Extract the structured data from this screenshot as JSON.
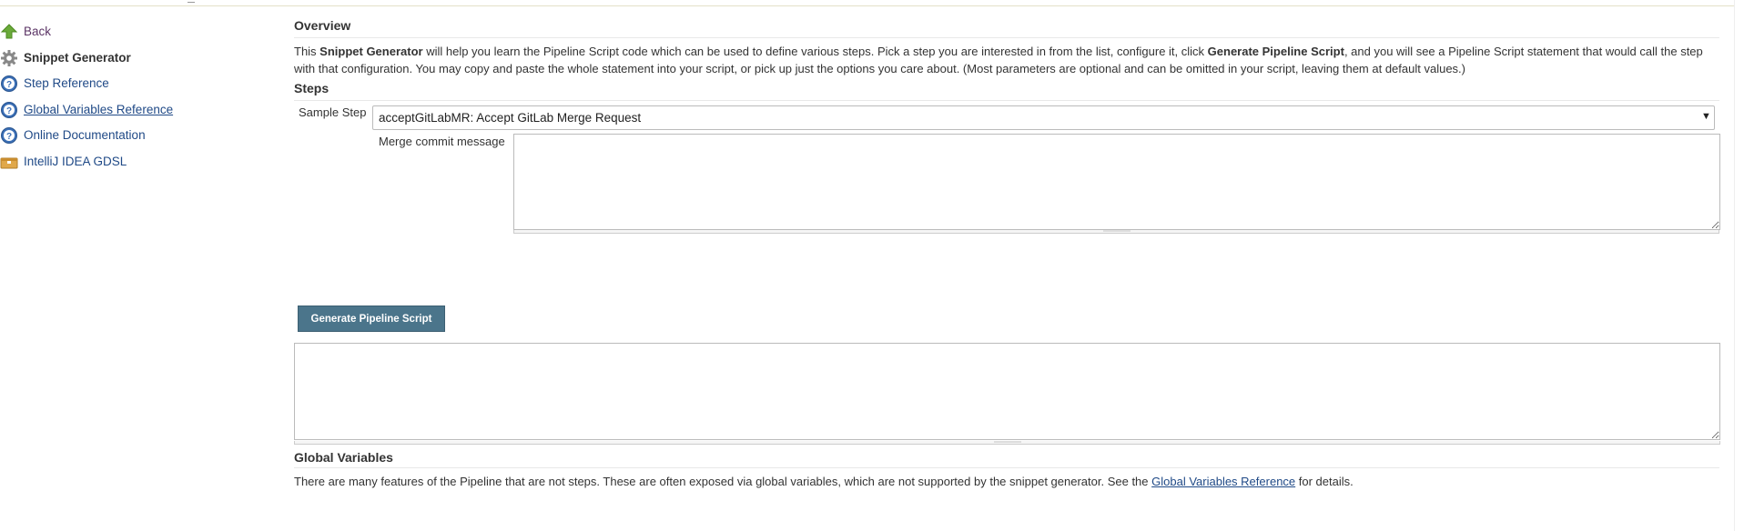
{
  "sidebar": {
    "items": [
      {
        "label": "Back",
        "icon": "up-arrow-icon"
      },
      {
        "label": "Snippet Generator",
        "icon": "gear-icon"
      },
      {
        "label": "Step Reference",
        "icon": "help-icon"
      },
      {
        "label": "Global Variables Reference",
        "icon": "help-icon"
      },
      {
        "label": "Online Documentation",
        "icon": "help-icon"
      },
      {
        "label": "IntelliJ IDEA GDSL",
        "icon": "package-icon"
      }
    ]
  },
  "overview": {
    "title": "Overview",
    "text_1": "This ",
    "bold_1": "Snippet Generator",
    "text_2": " will help you learn the Pipeline Script code which can be used to define various steps. Pick a step you are interested in from the list, configure it, click ",
    "bold_2": "Generate Pipeline Script",
    "text_3": ", and you will see a Pipeline Script statement that would call the step with that configuration. You may copy and paste the whole statement into your script, or pick up just the options you care about. (Most parameters are optional and can be omitted in your script, leaving them at default values.)"
  },
  "steps": {
    "title": "Steps",
    "sample_label": "Sample Step",
    "selected_step": "acceptGitLabMR: Accept GitLab Merge Request",
    "merge_label": "Merge commit message",
    "merge_value": ""
  },
  "generate": {
    "button_label": "Generate Pipeline Script",
    "output_value": ""
  },
  "global_variables": {
    "title": "Global Variables",
    "text_before": "There are many features of the Pipeline that are not steps. These are often exposed via global variables, which are not supported by the snippet generator. See the ",
    "link_label": "Global Variables Reference",
    "text_after": " for details."
  },
  "colors": {
    "link": "#204a87",
    "button_bg": "#4b758b",
    "back_link": "#5c3566"
  }
}
